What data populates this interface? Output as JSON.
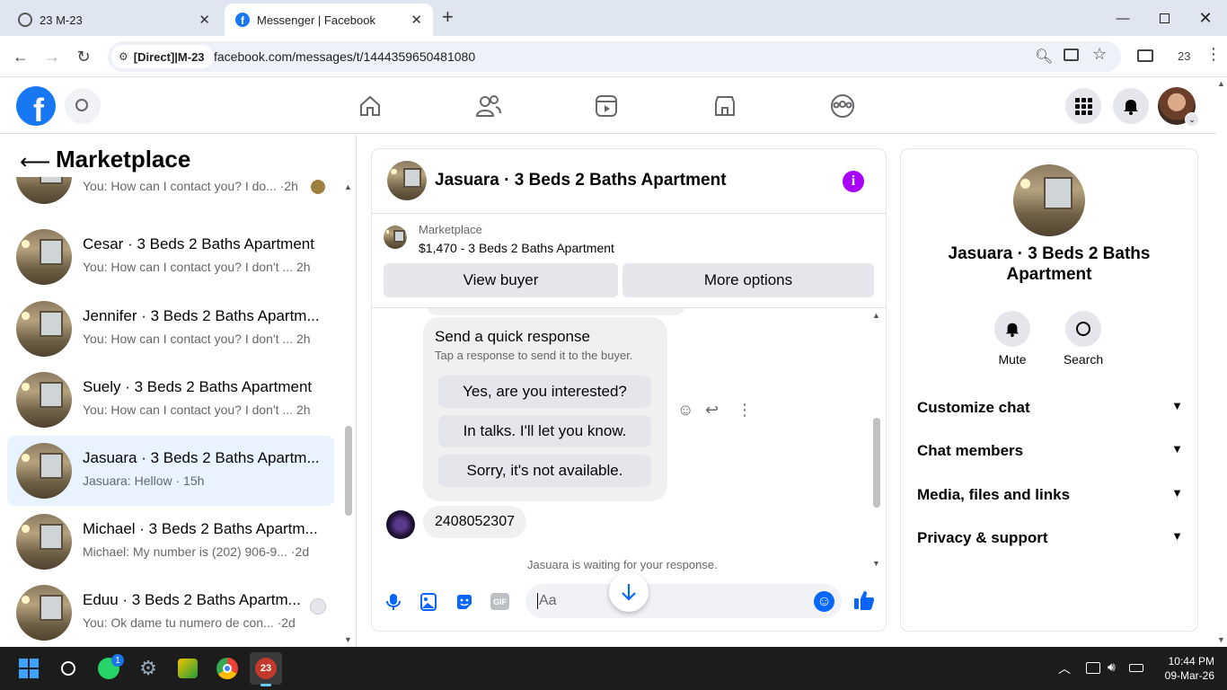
{
  "browser": {
    "tabs": [
      {
        "title": "23 M-23",
        "active": false
      },
      {
        "title": "Messenger | Facebook",
        "active": true
      }
    ],
    "new_tab_label": "+",
    "site_chip": "[Direct]|M-23",
    "url": "facebook.com/messages/t/1444359650481080",
    "profile_badge": "23"
  },
  "facebook": {
    "logo_letter": "f"
  },
  "sidebar": {
    "title": "Marketplace",
    "conversations": [
      {
        "name": "",
        "preview": "You: How can I contact you? I do... ·2h",
        "selected": false
      },
      {
        "name": "Cesar · 3 Beds 2 Baths Apartment",
        "preview": "You: How can I contact you? I don't ... 2h",
        "selected": false
      },
      {
        "name": "Jennifer · 3 Beds 2 Baths Apartm...",
        "preview": "You: How can I contact you? I don't ... 2h",
        "selected": false
      },
      {
        "name": "Suely · 3 Beds 2 Baths Apartment",
        "preview": "You: How can I contact you? I don't ... 2h",
        "selected": false
      },
      {
        "name": "Jasuara · 3 Beds 2 Baths Apartm...",
        "preview": "Jasuara: Hellow · 15h",
        "selected": true
      },
      {
        "name": "Michael · 3 Beds 2 Baths Apartm...",
        "preview": "Michael: My number is (202) 906-9... ·2d",
        "selected": false
      },
      {
        "name": "Eduu · 3 Beds 2 Baths Apartm...",
        "preview": "You: Ok dame tu numero de con... ·2d",
        "selected": false
      }
    ]
  },
  "chat": {
    "title": "Jasuara · 3 Beds 2 Baths Apartment",
    "info_glyph": "i",
    "listing_label": "Marketplace",
    "listing_detail": "$1,470 - 3 Beds 2 Baths Apartment",
    "view_buyer": "View buyer",
    "more_options": "More options",
    "quick_response_title": "Send a quick response",
    "quick_response_hint": "Tap a response to send it to the buyer.",
    "quick_responses": [
      "Yes, are you interested?",
      "In talks. I'll let you know.",
      "Sorry, it's not available."
    ],
    "message": "2408052307",
    "status": "Jasuara is waiting for your response.",
    "composer_placeholder": "Aa",
    "gif_label": "GIF"
  },
  "details": {
    "name": "Jasuara · 3 Beds 2 Baths Apartment",
    "mute_label": "Mute",
    "search_label": "Search",
    "sections": [
      "Customize chat",
      "Chat members",
      "Media, files and links",
      "Privacy & support"
    ]
  },
  "taskbar": {
    "time": "10:44 PM",
    "date": "09-Mar-26",
    "whatsapp_badge": "1",
    "app_badge": "23"
  },
  "colors": {
    "accent": "#0866ff",
    "fb_blue": "#1877f2",
    "info": "#aa00ff"
  }
}
